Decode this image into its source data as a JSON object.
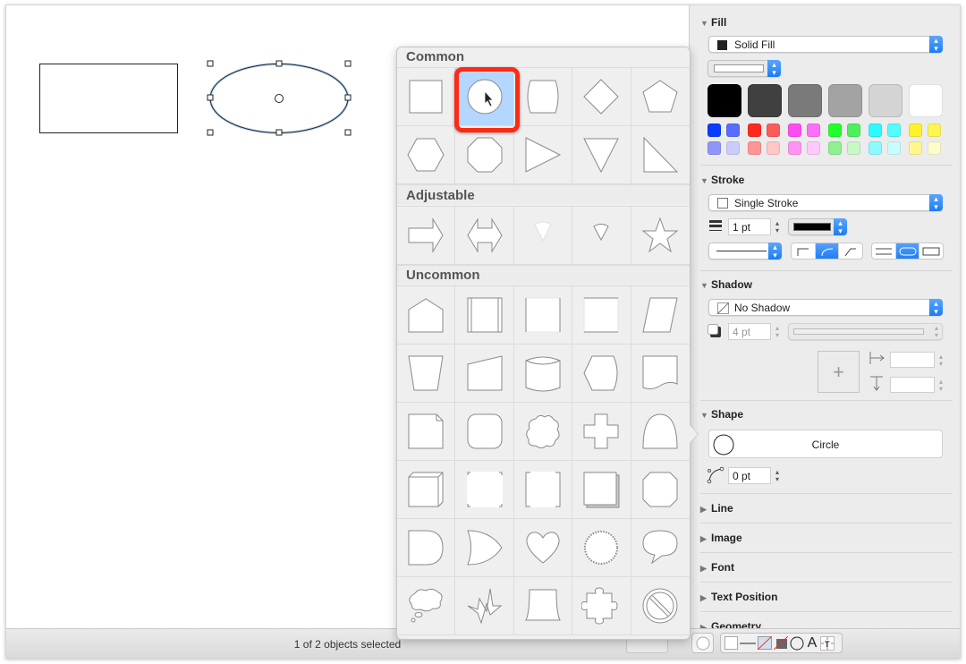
{
  "canvas": {
    "objects": [
      {
        "type": "rectangle",
        "selected": false
      },
      {
        "type": "ellipse",
        "selected": true
      }
    ]
  },
  "status": {
    "text": "1 of 2 objects selected"
  },
  "inspector": {
    "fill": {
      "title": "Fill",
      "type_label": "Solid Fill",
      "gray_swatches": [
        "#000000",
        "#404040",
        "#7a7a7a",
        "#a3a3a3",
        "#d4d4d4",
        "#ffffff"
      ],
      "color_swatches_row1": [
        "#0a3cff",
        "#5a6cff",
        "#ff2a1f",
        "#ff5a5a",
        "#ff4cf2",
        "#ff6ef7",
        "#22ff2e",
        "#4cf05e",
        "#2cfaff",
        "#53fcff",
        "#fff22a",
        "#fff552"
      ],
      "color_swatches_row2": [
        "#8e96f9",
        "#c9cdfb",
        "#ff9494",
        "#ffc6c6",
        "#ff94f2",
        "#ffc9fa",
        "#8ef08e",
        "#c8f7c8",
        "#8cfaff",
        "#c8fdff",
        "#fff78e",
        "#fffccc"
      ]
    },
    "stroke": {
      "title": "Stroke",
      "type_label": "Single Stroke",
      "width_value": "1 pt",
      "color": "#000000"
    },
    "shadow": {
      "title": "Shadow",
      "type_label": "No Shadow",
      "blur_value": "4 pt",
      "offset_x": "",
      "offset_y": ""
    },
    "shape": {
      "title": "Shape",
      "name": "Circle",
      "corner_radius": "0 pt"
    },
    "collapsed_sections": [
      "Line",
      "Image",
      "Font",
      "Text Position",
      "Geometry"
    ]
  },
  "shape_picker": {
    "groups": [
      {
        "title": "Common",
        "shapes": [
          "rectangle",
          "circle",
          "rounded-rectangle",
          "diamond",
          "pentagon",
          "hexagon",
          "octagon",
          "triangle-right",
          "triangle-down",
          "right-triangle"
        ]
      },
      {
        "title": "Adjustable",
        "shapes": [
          "arrow-right",
          "double-arrow",
          "wedge-wide",
          "wedge-narrow",
          "star"
        ]
      },
      {
        "title": "Uncommon",
        "shapes": [
          "house",
          "bracketed-rect",
          "plain-rect",
          "plain-rect-2",
          "parallelogram",
          "trapezoid",
          "manual-input",
          "cylinder",
          "display",
          "document",
          "folded-page",
          "rounded-square",
          "cloud",
          "cross",
          "bullet",
          "cube",
          "notched-rect",
          "notched-rect-2",
          "stacked-pages",
          "octagon-cut",
          "delay",
          "or-gate",
          "heart",
          "starburst",
          "speech-bubble",
          "thought-bubble",
          "lightning",
          "trapezoid-curved",
          "puzzle-piece",
          "prohibited"
        ]
      }
    ],
    "selected_shape": "circle"
  }
}
